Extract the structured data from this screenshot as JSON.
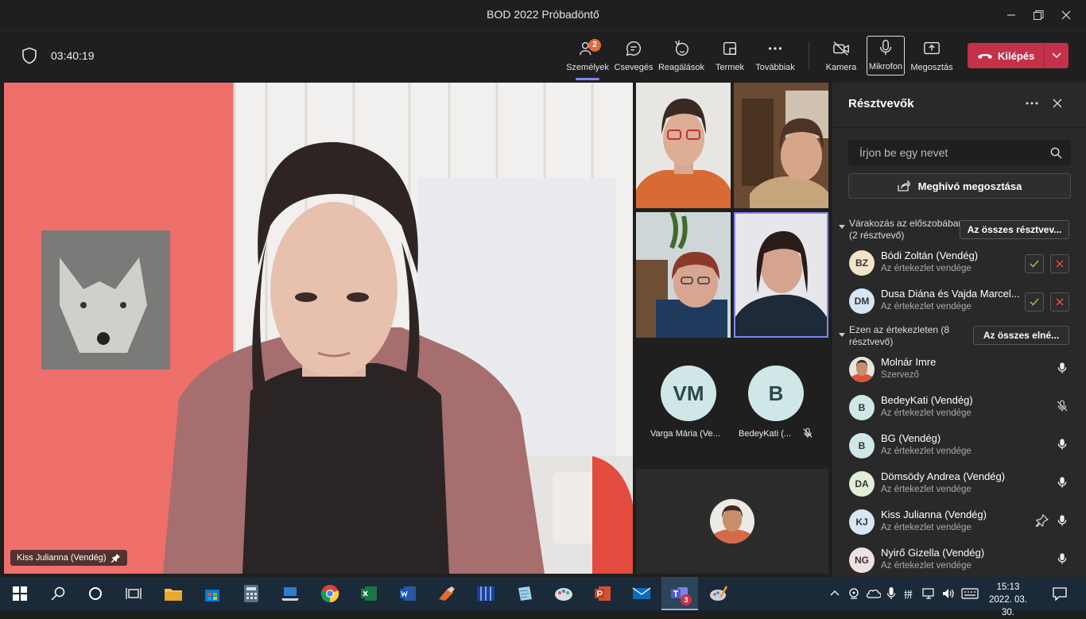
{
  "window": {
    "title": "BOD 2022 Próbadöntő"
  },
  "toolbar": {
    "timer": "03:40:19",
    "people_label": "Személyek",
    "people_badge": "2",
    "chat_label": "Csevegés",
    "reactions_label": "Reagálások",
    "rooms_label": "Termek",
    "more_label": "Továbbiak",
    "camera_label": "Kamera",
    "mic_label": "Mikrofon",
    "share_label": "Megosztás",
    "leave_label": "Kilépés"
  },
  "stage": {
    "pinned_name": "Kiss Julianna (Vendég)"
  },
  "gallery": {
    "tiles": [
      {
        "initials": "VM",
        "name": "Varga Mária (Ve..."
      },
      {
        "initials": "B",
        "name": "BedeyKati (..."
      }
    ]
  },
  "panel": {
    "title": "Résztvevők",
    "search_placeholder": "Írjon be egy nevet",
    "share_invite": "Meghívó megosztása",
    "lobby": {
      "label_line1": "Várakozás az előszobában",
      "label_line2": "(2 résztvevő)",
      "action": "Az összes résztvev...",
      "people": [
        {
          "initials": "BZ",
          "name": "Bódi Zoltán (Vendég)",
          "role": "Az értekezlet vendége",
          "color": "#f3e3c8"
        },
        {
          "initials": "DM",
          "name": "Dusa Diána és Vajda Marcel...",
          "role": "Az értekezlet vendége",
          "color": "#d7e6f4"
        }
      ]
    },
    "meeting": {
      "label_line1": "Ezen az értekezleten (8",
      "label_line2": "résztvevő)",
      "action": "Az összes elné...",
      "people": [
        {
          "initials": "",
          "name": "Molnár Imre",
          "role": "Szervező",
          "color": "#c9a58c"
        },
        {
          "initials": "B",
          "name": "BedeyKati (Vendég)",
          "role": "Az értekezlet vendége",
          "color": "#cfe7e7"
        },
        {
          "initials": "B",
          "name": "BG (Vendég)",
          "role": "Az értekezlet vendége",
          "color": "#cfe7e7"
        },
        {
          "initials": "DA",
          "name": "Dömsödy Andrea (Vendég)",
          "role": "Az értekezlet vendége",
          "color": "#e3eed7"
        },
        {
          "initials": "KJ",
          "name": "Kiss Julianna (Vendég)",
          "role": "Az értekezlet vendége",
          "color": "#d7e6f4"
        },
        {
          "initials": "NG",
          "name": "Nyirő Gizella (Vendég)",
          "role": "Az értekezlet vendége",
          "color": "#efe1e1"
        }
      ]
    }
  },
  "taskbar": {
    "teams_badge": "3",
    "time": "15:13",
    "date": "2022. 03. 30."
  }
}
